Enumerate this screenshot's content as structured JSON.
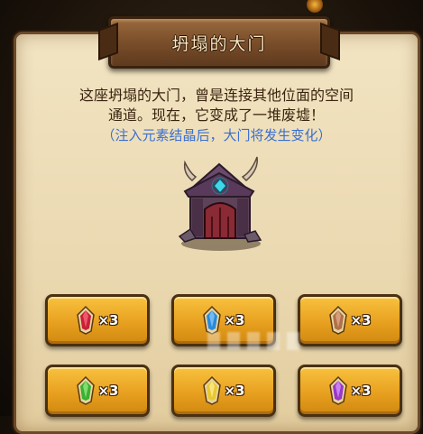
{
  "title": "坍塌的大门",
  "description": {
    "line1": "这座坍塌的大门，曾是连接其他位面的空间",
    "line2": "通道。现在，它变成了一堆废墟！",
    "hint": "（注入元素结晶后，大门将发生变化）"
  },
  "crystals": [
    {
      "color": "#c8203a",
      "count": "×3",
      "icon": "red-crystal-icon"
    },
    {
      "color": "#2a8ad8",
      "count": "×3",
      "icon": "blue-crystal-icon"
    },
    {
      "color": "#b07048",
      "count": "×3",
      "icon": "brown-crystal-icon"
    },
    {
      "color": "#3ab030",
      "count": "×3",
      "icon": "green-crystal-icon"
    },
    {
      "color": "#e8c830",
      "count": "×3",
      "icon": "yellow-crystal-icon"
    },
    {
      "color": "#9a38c8",
      "count": "×3",
      "icon": "purple-crystal-icon"
    }
  ],
  "colors": {
    "panel": "#ead8b0",
    "slot": "#e8a020",
    "hint": "#3a6fd0"
  }
}
